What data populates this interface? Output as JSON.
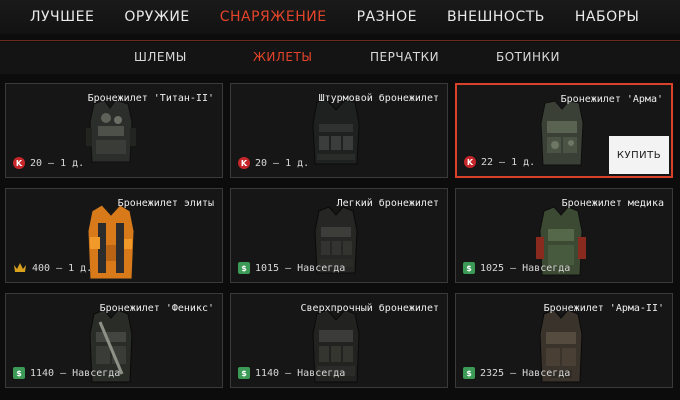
{
  "top_tabs": [
    {
      "label": "ЛУЧШЕЕ"
    },
    {
      "label": "ОРУЖИЕ"
    },
    {
      "label": "СНАРЯЖЕНИЕ"
    },
    {
      "label": "РАЗНОЕ"
    },
    {
      "label": "ВНЕШНОСТЬ"
    },
    {
      "label": "НАБОРЫ"
    }
  ],
  "active_top_tab": "СНАРЯЖЕНИЕ",
  "sub_tabs": [
    {
      "label": "ШЛЕМЫ"
    },
    {
      "label": "ЖИЛЕТЫ"
    },
    {
      "label": "ПЕРЧАТКИ"
    },
    {
      "label": "БОТИНКИ"
    }
  ],
  "active_sub_tab": "ЖИЛЕТЫ",
  "items": [
    {
      "title": "Бронежилет 'Титан-II'",
      "price": "20 – 1 д.",
      "currency": "K",
      "currency_icon": "kredit-icon"
    },
    {
      "title": "Штурмовой бронежилет",
      "price": "20 – 1 д.",
      "currency": "K",
      "currency_icon": "kredit-icon"
    },
    {
      "title": "Бронежилет 'Арма'",
      "price": "22 – 1 д.",
      "currency": "K",
      "currency_icon": "kredit-icon",
      "selected": true,
      "buy_label": "КУПИТЬ"
    },
    {
      "title": "Бронежилет элиты",
      "price": "400 – 1 д.",
      "currency": "",
      "currency_icon": "crown-icon"
    },
    {
      "title": "Легкий бронежилет",
      "price": "1015 – Навсегда",
      "currency": "$",
      "currency_icon": "dollar-icon"
    },
    {
      "title": "Бронежилет медика",
      "price": "1025 – Навсегда",
      "currency": "$",
      "currency_icon": "dollar-icon"
    },
    {
      "title": "Бронежилет 'Феникс'",
      "price": "1140 – Навсегда",
      "currency": "$",
      "currency_icon": "dollar-icon"
    },
    {
      "title": "Сверхпрочный бронежилет",
      "price": "1140 – Навсегда",
      "currency": "$",
      "currency_icon": "dollar-icon"
    },
    {
      "title": "Бронежилет 'Арма-II'",
      "price": "2325 – Навсегда",
      "currency": "$",
      "currency_icon": "dollar-icon"
    }
  ],
  "colors": {
    "accent": "#e4442a",
    "kredit": "#c7272a",
    "dollar": "#3b9a55",
    "crown": "#d8a21e"
  }
}
